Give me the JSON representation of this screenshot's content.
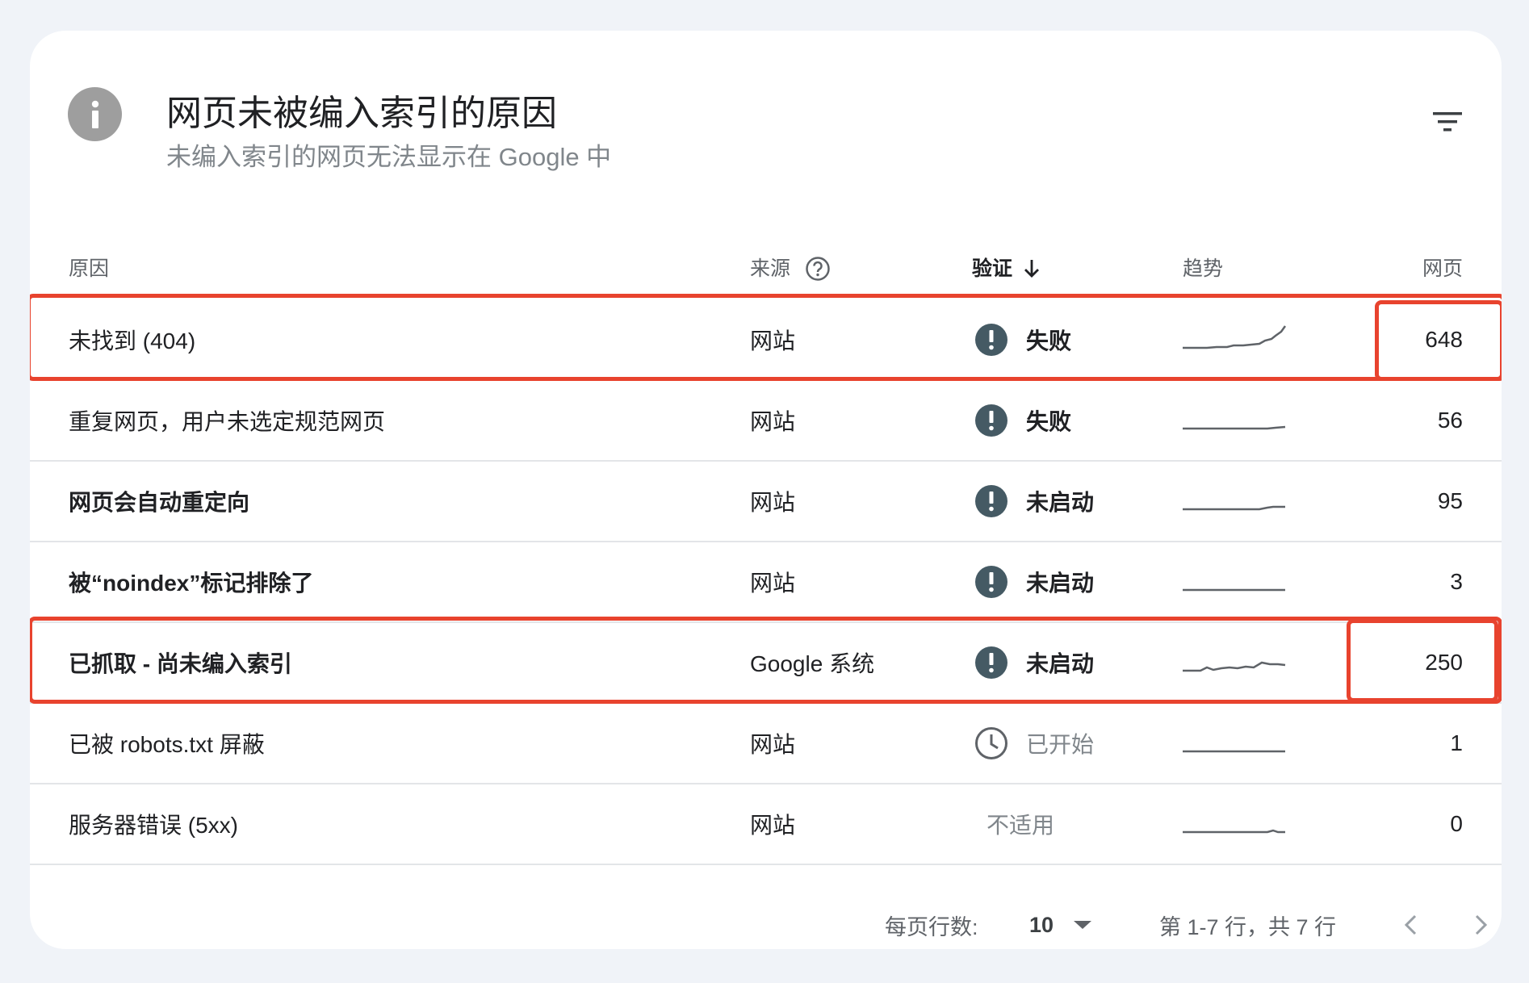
{
  "header": {
    "title": "网页未被编入索引的原因",
    "subtitle": "未编入索引的网页无法显示在 Google 中"
  },
  "columns": {
    "reason": "原因",
    "source": "来源",
    "verification": "验证",
    "trend": "趋势",
    "pages": "网页"
  },
  "rows": [
    {
      "reason": "未找到 (404)",
      "source": "网站",
      "status": "失败",
      "status_icon": "error-icon",
      "pages": "648",
      "bold": false
    },
    {
      "reason": "重复网页，用户未选定规范网页",
      "source": "网站",
      "status": "失败",
      "status_icon": "error-icon",
      "pages": "56",
      "bold": false
    },
    {
      "reason": "网页会自动重定向",
      "source": "网站",
      "status": "未启动",
      "status_icon": "error-icon",
      "pages": "95",
      "bold": true
    },
    {
      "reason": "被“noindex”标记排除了",
      "source": "网站",
      "status": "未启动",
      "status_icon": "error-icon",
      "pages": "3",
      "bold": true
    },
    {
      "reason": "已抓取 - 尚未编入索引",
      "source": "Google 系统",
      "status": "未启动",
      "status_icon": "error-icon",
      "pages": "250",
      "bold": true
    },
    {
      "reason": "已被 robots.txt 屏蔽",
      "source": "网站",
      "status": "已开始",
      "status_icon": "clock-icon",
      "pages": "1",
      "bold": false
    },
    {
      "reason": "服务器错误 (5xx)",
      "source": "网站",
      "status": "不适用",
      "status_icon": "",
      "pages": "0",
      "bold": false
    }
  ],
  "pagination": {
    "rows_per_page_label": "每页行数:",
    "rows_per_page_value": "10",
    "range_text": "第 1-7 行，共 7 行"
  },
  "colors": {
    "highlight": "#e8432e",
    "status_icon": "#455a64",
    "sparkline": "#5f6368"
  }
}
